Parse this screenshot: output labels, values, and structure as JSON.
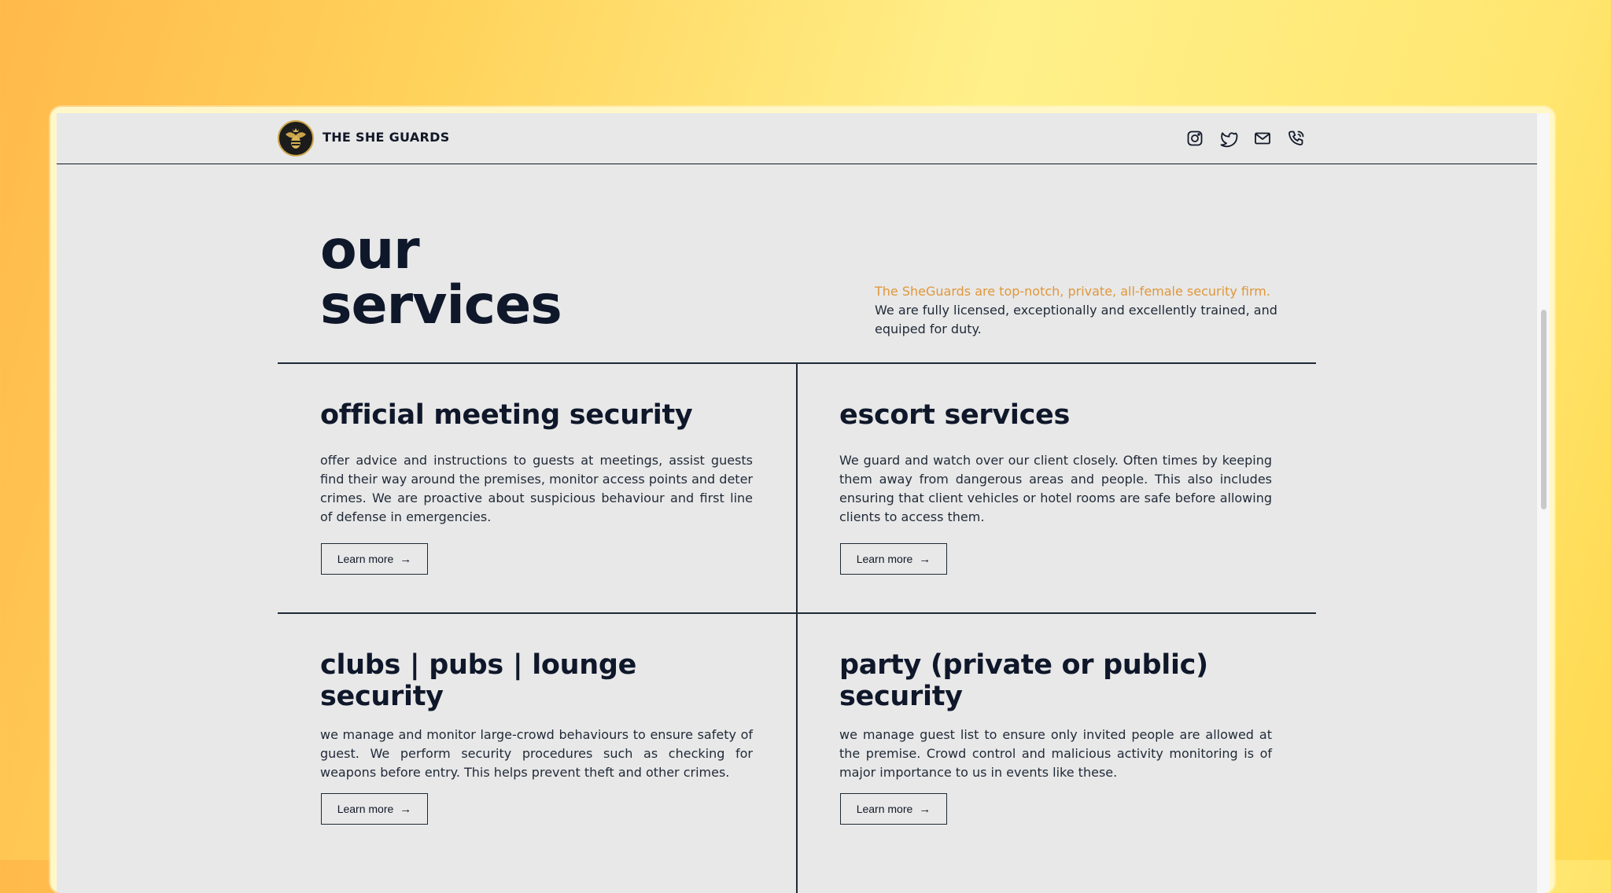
{
  "nav": {
    "brand": "THE SHE GUARDS",
    "icons": [
      "instagram-icon",
      "twitter-icon",
      "mail-icon",
      "phone-icon"
    ]
  },
  "hero": {
    "title_line1": "our",
    "title_line2": "services",
    "desc_highlight": "The SheGuards are top-notch, private, all-female security firm.",
    "desc_rest": " We are fully licensed, exceptionally and excellently trained, and equiped for duty."
  },
  "services": [
    {
      "title": "official meeting security",
      "text": "offer advice and instructions to guests at meetings, assist guests find their way around the premises, monitor access points and deter crimes. We are proactive about suspicious behaviour and first line of defense in emergencies.",
      "button": "Learn more"
    },
    {
      "title": "escort services",
      "text": "We guard and watch over our client closely. Often times by keeping them away from dangerous areas and people. This also includes ensuring that client vehicles or hotel rooms are safe before allowing clients to access them.",
      "button": "Learn more"
    },
    {
      "title": "clubs | pubs | lounge security",
      "text": "we manage and monitor large-crowd behaviours to ensure safety of guest. We perform security procedures such as checking for weapons before entry. This helps prevent theft and other crimes.",
      "button": "Learn more"
    },
    {
      "title": "party (private or public) security",
      "text": "we manage guest list to ensure only invited people are allowed at the premise. Crowd control and malicious activity monitoring is of major importance to us in events like these.",
      "button": "Learn more"
    }
  ],
  "colors": {
    "accent": "#e0973a",
    "text": "#0f172a",
    "page_bg": "#e8e8e8"
  }
}
